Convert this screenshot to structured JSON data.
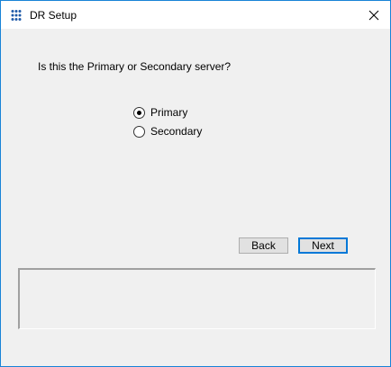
{
  "window": {
    "title": "DR Setup",
    "close_glyph": "✕",
    "app_icon": "dots-grid-icon"
  },
  "dialog": {
    "question": "Is this the Primary or Secondary server?",
    "options": [
      {
        "label": "Primary",
        "selected": true
      },
      {
        "label": "Secondary",
        "selected": false
      }
    ],
    "buttons": {
      "back_label": "Back",
      "next_label": "Next"
    },
    "status_text": ""
  },
  "colors": {
    "accent": "#0078d7",
    "window_border": "#1883d7",
    "icon_blue": "#1e5aa8"
  }
}
